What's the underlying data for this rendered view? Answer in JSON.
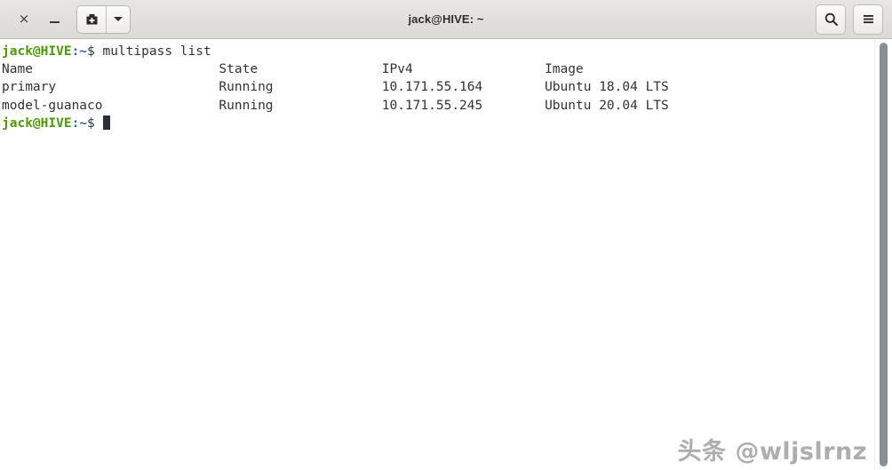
{
  "window": {
    "title": "jack@HIVE: ~",
    "controls": {
      "close_label": "×",
      "close_icon": "close-icon",
      "minimize_label": "–",
      "minimize_icon": "minimize-icon",
      "new_terminal_icon": "new-terminal-plus-icon",
      "dropdown_icon": "chevron-down-icon",
      "search_icon": "search-icon",
      "menu_icon": "hamburger-menu-icon"
    }
  },
  "terminal": {
    "prompt": {
      "user_host": "jack@HIVE",
      "path": ":~",
      "symbol": "$"
    },
    "command": "multipass list",
    "table": {
      "headers": [
        "Name",
        "State",
        "IPv4",
        "Image"
      ],
      "rows": [
        [
          "primary",
          "Running",
          "10.171.55.164",
          "Ubuntu 18.04 LTS"
        ],
        [
          "model-guanaco",
          "Running",
          "10.171.55.245",
          "Ubuntu 20.04 LTS"
        ]
      ]
    },
    "columns": {
      "name_width": 28,
      "state_width": 21,
      "ipv4_width": 21
    },
    "cursor_visible": true,
    "colors": {
      "background": "#ffffff",
      "foreground": "#2f3437",
      "prompt_user": "#4e9a06",
      "prompt_path": "#3465a4",
      "cursor": "#2b3034"
    }
  },
  "watermark": {
    "text": "头条 @wljslrnz"
  }
}
